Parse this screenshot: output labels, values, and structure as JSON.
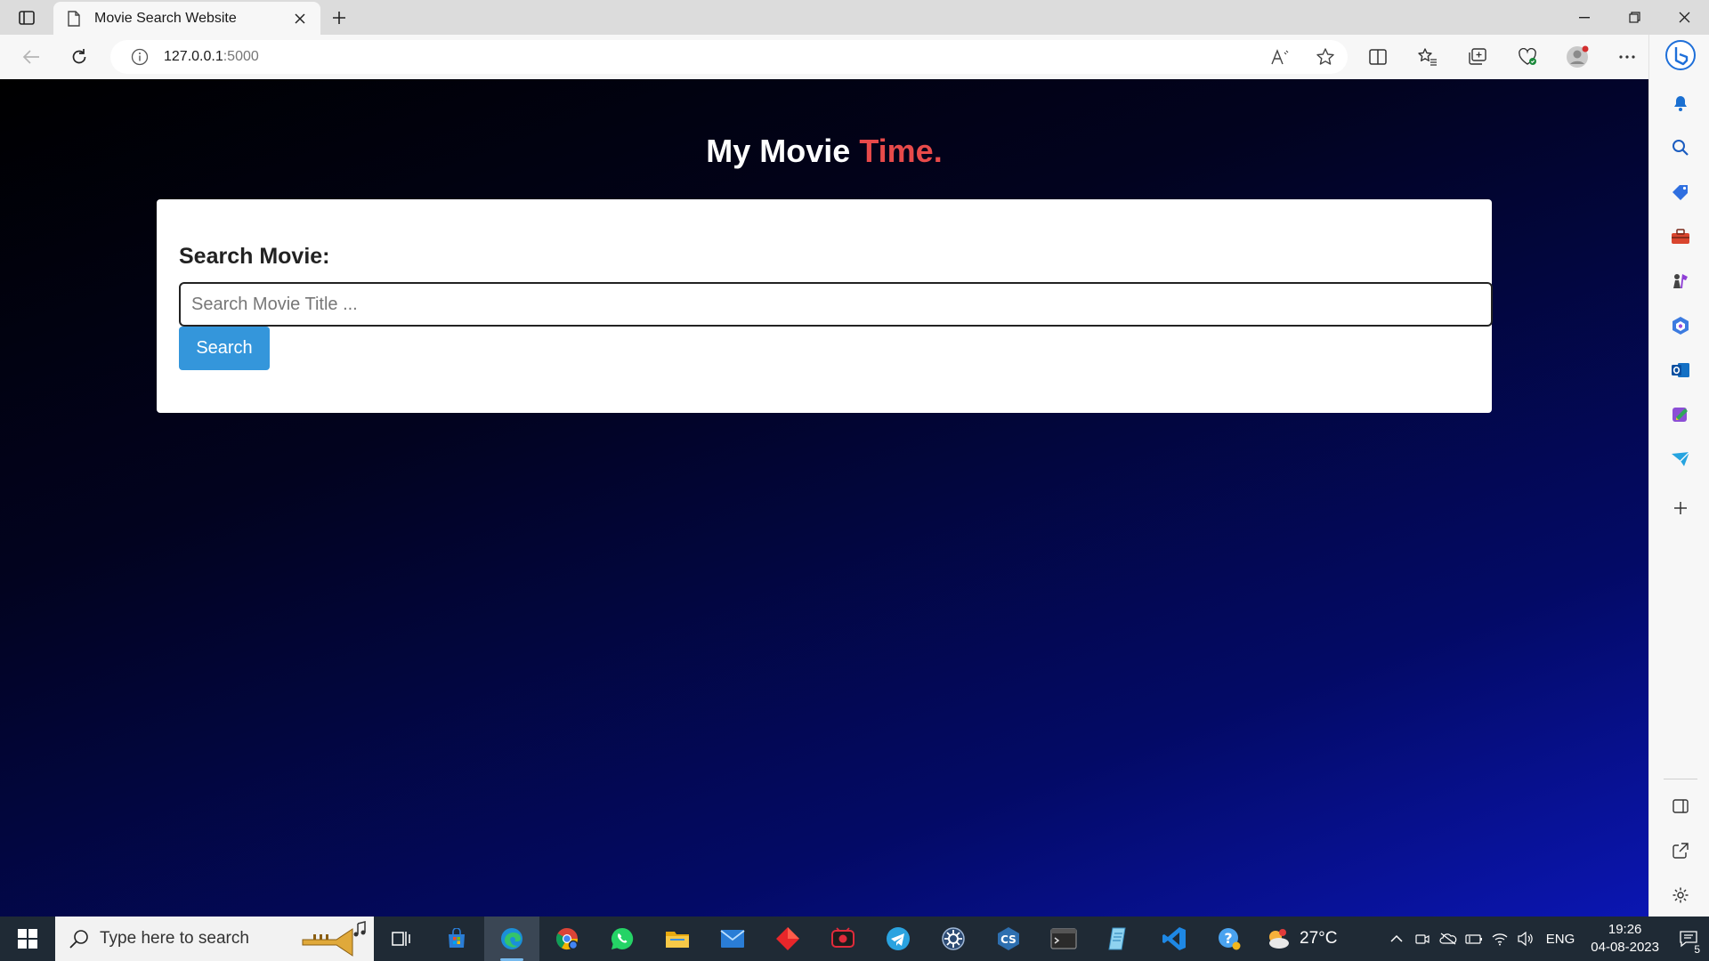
{
  "browser": {
    "tab_title": "Movie Search Website",
    "url_host": "127.0.0.1",
    "url_port": ":5000"
  },
  "page": {
    "brand_main": "My Movie ",
    "brand_accent": "Time.",
    "search_label": "Search Movie:",
    "search_placeholder": "Search Movie Title ...",
    "search_value": "",
    "search_button": "Search"
  },
  "taskbar": {
    "search_placeholder": "Type here to search",
    "apps": [
      "task-view",
      "microsoft-store",
      "edge",
      "chrome",
      "whatsapp",
      "file-explorer",
      "mail",
      "red-app",
      "recorder",
      "telegram",
      "settings-app",
      "cs-app",
      "terminal",
      "notepad",
      "vscode",
      "help"
    ],
    "weather_temp": "27°C",
    "language": "ENG",
    "time": "19:26",
    "date": "04-08-2023",
    "notification_count": "5"
  },
  "colors": {
    "accent_red": "#e84a4a",
    "button_blue": "#3496db",
    "bg_dark": "#000000",
    "bg_blue": "#0b16b2"
  }
}
